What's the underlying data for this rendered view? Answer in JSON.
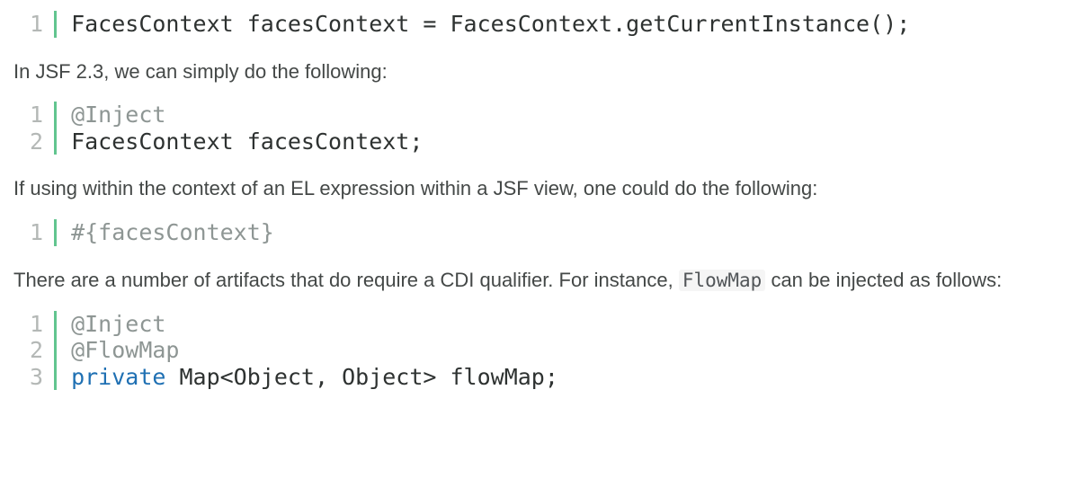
{
  "block1": {
    "lines": [
      {
        "n": "1",
        "segs": [
          {
            "cls": "tok-default",
            "t": "FacesContext facesContext = FacesContext.getCurrentInstance();"
          }
        ]
      }
    ]
  },
  "para1": "In JSF 2.3, we can simply do the following:",
  "block2": {
    "lines": [
      {
        "n": "1",
        "segs": [
          {
            "cls": "tok-anno",
            "t": "@Inject"
          }
        ]
      },
      {
        "n": "2",
        "segs": [
          {
            "cls": "tok-default",
            "t": "FacesContext facesContext;"
          }
        ]
      }
    ]
  },
  "para2": "If using within the context of an EL expression within a JSF view, one could do the following:",
  "block3": {
    "lines": [
      {
        "n": "1",
        "segs": [
          {
            "cls": "tok-el",
            "t": "#{facesContext}"
          }
        ]
      }
    ]
  },
  "para3_a": "There are a number of artifacts that do require a CDI qualifier.  For instance, ",
  "para3_code": "FlowMap",
  "para3_b": " can be injected as follows:",
  "block4": {
    "lines": [
      {
        "n": "1",
        "segs": [
          {
            "cls": "tok-anno",
            "t": "@Inject"
          }
        ]
      },
      {
        "n": "2",
        "segs": [
          {
            "cls": "tok-anno",
            "t": "@FlowMap"
          }
        ]
      },
      {
        "n": "3",
        "segs": [
          {
            "cls": "tok-kw",
            "t": "private"
          },
          {
            "cls": "tok-default",
            "t": " Map<Object, Object> flowMap;"
          }
        ]
      }
    ]
  }
}
